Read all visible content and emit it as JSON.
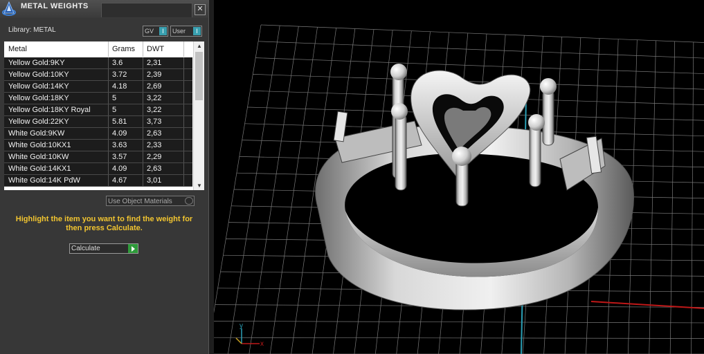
{
  "panel": {
    "title": "METAL WEIGHTS",
    "close_symbol": "✕",
    "library_label": "Library: METAL",
    "filters": [
      {
        "label": "GV",
        "indicator": "I"
      },
      {
        "label": "User",
        "indicator": "I"
      }
    ],
    "table": {
      "columns": [
        "Metal",
        "Grams",
        "DWT"
      ],
      "rows": [
        {
          "metal": "Yellow Gold:9KY",
          "grams": "3.6",
          "dwt": "2,31"
        },
        {
          "metal": "Yellow Gold:10KY",
          "grams": "3.72",
          "dwt": "2,39"
        },
        {
          "metal": "Yellow Gold:14KY",
          "grams": "4.18",
          "dwt": "2,69"
        },
        {
          "metal": "Yellow Gold:18KY",
          "grams": "5",
          "dwt": "3,22"
        },
        {
          "metal": "Yellow Gold:18KY Royal",
          "grams": "5",
          "dwt": "3,22"
        },
        {
          "metal": "Yellow Gold:22KY",
          "grams": "5.81",
          "dwt": "3,73"
        },
        {
          "metal": "White Gold:9KW",
          "grams": "4.09",
          "dwt": "2,63"
        },
        {
          "metal": "White Gold:10KX1",
          "grams": "3.63",
          "dwt": "2,33"
        },
        {
          "metal": "White Gold:10KW",
          "grams": "3.57",
          "dwt": "2,29"
        },
        {
          "metal": "White Gold:14KX1",
          "grams": "4.09",
          "dwt": "2,63"
        },
        {
          "metal": "White Gold:14K PdW",
          "grams": "4.67",
          "dwt": "3,01"
        }
      ]
    },
    "use_materials_label": "Use Object Materials",
    "instructions": "Highlight the item you want to find the weight for then press Calculate.",
    "calculate_label": "Calculate"
  },
  "viewport": {
    "axis_labels": {
      "x": "x",
      "y": "y"
    },
    "colors": {
      "grid": "#7a7a7a",
      "axis_x": "#c01818",
      "axis_y": "#2a9fb5",
      "accent_text": "#f2c530"
    }
  }
}
